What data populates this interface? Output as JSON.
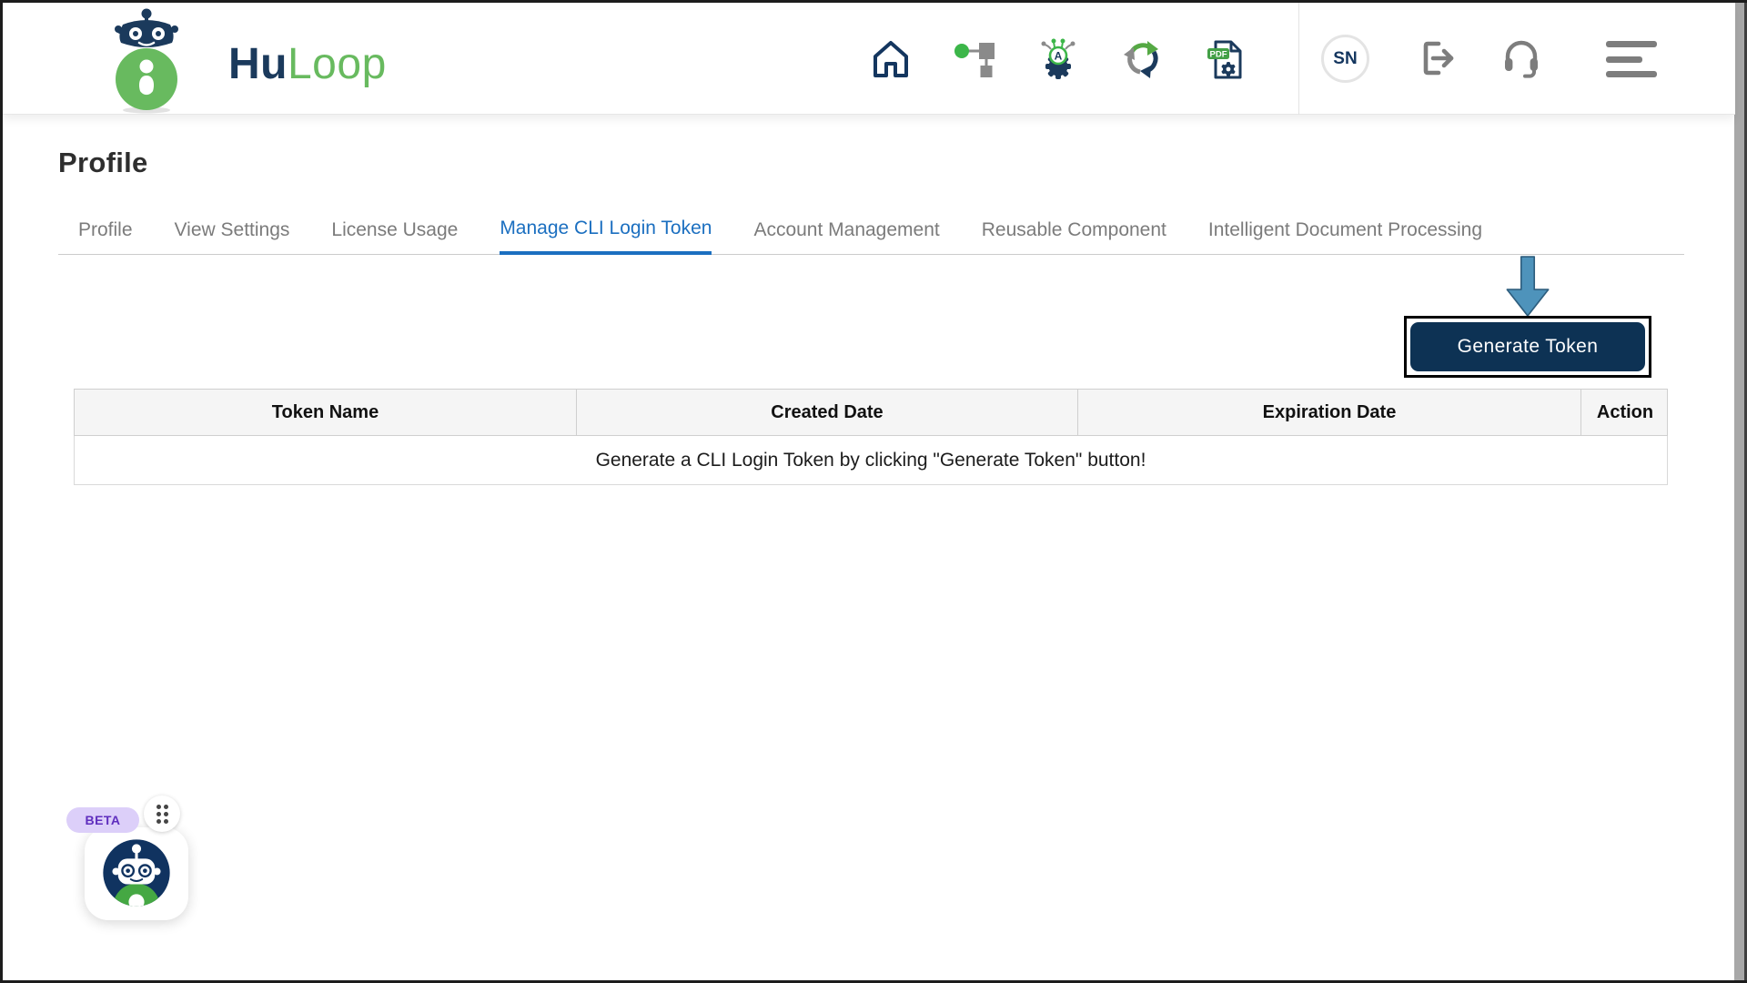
{
  "brand": {
    "name_primary": "Hu",
    "name_secondary": "Loop"
  },
  "header": {
    "icons": [
      {
        "name": "home-icon"
      },
      {
        "name": "workflow-icon"
      },
      {
        "name": "automation-gear-icon"
      },
      {
        "name": "sync-icon"
      },
      {
        "name": "pdf-settings-icon"
      }
    ],
    "avatar_initials": "SN",
    "right_icons": [
      {
        "name": "logout-icon"
      },
      {
        "name": "headset-icon"
      },
      {
        "name": "menu-icon"
      }
    ]
  },
  "page": {
    "title": "Profile"
  },
  "tabs": [
    {
      "label": "Profile",
      "active": false
    },
    {
      "label": "View Settings",
      "active": false
    },
    {
      "label": "License Usage",
      "active": false
    },
    {
      "label": "Manage CLI Login Token",
      "active": true
    },
    {
      "label": "Account Management",
      "active": false
    },
    {
      "label": "Reusable Component",
      "active": false
    },
    {
      "label": "Intelligent Document Processing",
      "active": false
    }
  ],
  "cli_token": {
    "generate_button_label": "Generate Token",
    "table": {
      "columns": [
        "Token Name",
        "Created Date",
        "Expiration Date",
        "Action"
      ],
      "empty_message": "Generate a CLI Login Token by clicking \"Generate Token\" button!"
    }
  },
  "assistant_widget": {
    "beta_label": "BETA"
  },
  "colors": {
    "brand_navy": "#1B3A5C",
    "brand_green": "#68BA5F",
    "active_tab_blue": "#1B6FC0",
    "button_navy": "#0D3254",
    "annotation_arrow_blue": "#4E93BB",
    "workflow_green": "#3CB649",
    "pdf_badge_green": "#43A047",
    "beta_pill_bg": "#DCCFF9",
    "beta_text": "#5F2EBE",
    "icon_gray": "#7D7D7D",
    "table_header_bg": "#F5F5F5"
  }
}
